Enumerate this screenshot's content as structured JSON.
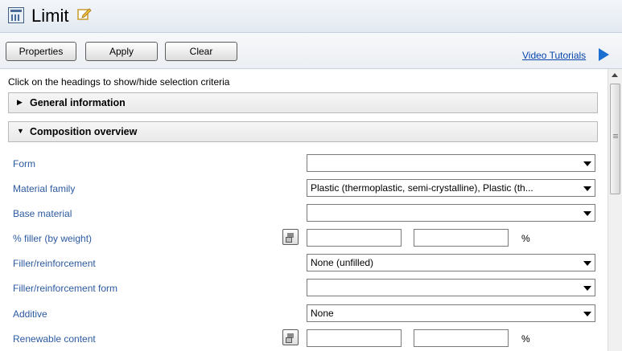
{
  "window": {
    "title": "Limit"
  },
  "toolbar": {
    "properties_label": "Properties",
    "apply_label": "Apply",
    "clear_label": "Clear",
    "video_tutorials_label": "Video Tutorials"
  },
  "content": {
    "instruction": "Click on the headings to show/hide selection criteria",
    "sections": [
      {
        "label": "General information",
        "expanded": false
      },
      {
        "label": "Composition overview",
        "expanded": true
      }
    ],
    "fields": [
      {
        "label": "Form",
        "type": "select",
        "value": ""
      },
      {
        "label": "Material family",
        "type": "select",
        "value": "Plastic (thermoplastic, semi-crystalline), Plastic (th..."
      },
      {
        "label": "Base material",
        "type": "select",
        "value": ""
      },
      {
        "label": "% filler (by weight)",
        "type": "range",
        "min": "",
        "max": "",
        "unit": "%"
      },
      {
        "label": "Filler/reinforcement",
        "type": "select",
        "value": "None (unfilled)"
      },
      {
        "label": "Filler/reinforcement form",
        "type": "select",
        "value": ""
      },
      {
        "label": "Additive",
        "type": "select",
        "value": "None"
      },
      {
        "label": "Renewable content",
        "type": "range",
        "min": "",
        "max": "",
        "unit": "%"
      }
    ]
  },
  "colors": {
    "label_blue": "#2c5aa0",
    "link_blue": "#0645ad",
    "play_blue": "#1b6fd0"
  },
  "icons": [
    "window-form-icon",
    "edit-pencil-icon",
    "play-icon",
    "expand-arrow-icon",
    "collapse-arrow-icon",
    "dropdown-arrow-icon",
    "calculator-icon"
  ]
}
